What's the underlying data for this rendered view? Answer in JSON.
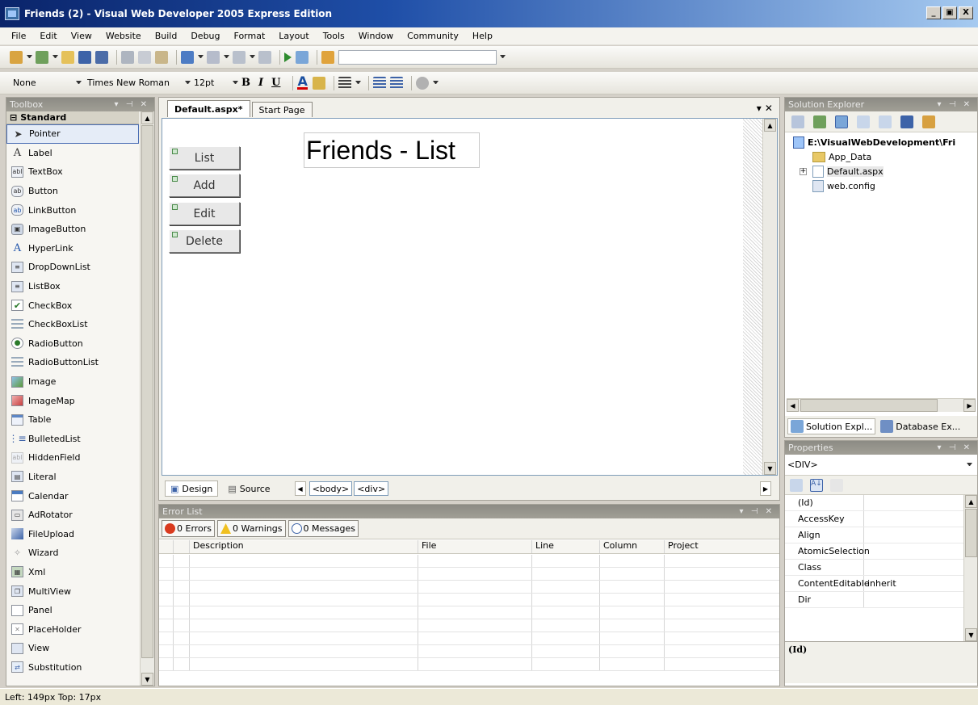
{
  "window": {
    "title": "Friends (2) - Visual Web Developer 2005 Express Edition"
  },
  "menu": [
    "File",
    "Edit",
    "View",
    "Website",
    "Build",
    "Debug",
    "Format",
    "Layout",
    "Tools",
    "Window",
    "Community",
    "Help"
  ],
  "format_toolbar": {
    "block_format": "None",
    "font": "Times New Roman",
    "size": "12pt",
    "bold": "B",
    "italic": "I",
    "underline": "U",
    "color_a": "A"
  },
  "toolbox": {
    "title": "Toolbox",
    "group": "Standard",
    "items": [
      "Pointer",
      "Label",
      "TextBox",
      "Button",
      "LinkButton",
      "ImageButton",
      "HyperLink",
      "DropDownList",
      "ListBox",
      "CheckBox",
      "CheckBoxList",
      "RadioButton",
      "RadioButtonList",
      "Image",
      "ImageMap",
      "Table",
      "BulletedList",
      "HiddenField",
      "Literal",
      "Calendar",
      "AdRotator",
      "FileUpload",
      "Wizard",
      "Xml",
      "MultiView",
      "Panel",
      "PlaceHolder",
      "View",
      "Substitution"
    ]
  },
  "doc": {
    "tabs": [
      "Default.aspx*",
      "Start Page"
    ],
    "buttons": [
      "List",
      "Add",
      "Edit",
      "Delete"
    ],
    "page_title": "Friends - List",
    "views": [
      "Design",
      "Source"
    ],
    "crumbs": [
      "<body>",
      "<div>"
    ]
  },
  "errors": {
    "title": "Error List",
    "errors_label": "0 Errors",
    "warnings_label": "0 Warnings",
    "messages_label": "0 Messages",
    "columns": [
      "Description",
      "File",
      "Line",
      "Column",
      "Project"
    ]
  },
  "solution": {
    "title": "Solution Explorer",
    "root": "E:\\VisualWebDevelopment\\Fri",
    "items": [
      "App_Data",
      "Default.aspx",
      "web.config"
    ],
    "tab1": "Solution Expl...",
    "tab2": "Database Ex..."
  },
  "properties": {
    "title": "Properties",
    "object": "<DIV>",
    "rows": [
      {
        "name": "(Id)",
        "value": ""
      },
      {
        "name": "AccessKey",
        "value": ""
      },
      {
        "name": "Align",
        "value": ""
      },
      {
        "name": "AtomicSelection",
        "value": ""
      },
      {
        "name": "Class",
        "value": ""
      },
      {
        "name": "ContentEditable",
        "value": "inherit"
      },
      {
        "name": "Dir",
        "value": ""
      }
    ],
    "desc": "(Id)"
  },
  "status": {
    "text": "Left: 149px  Top: 17px"
  },
  "colors": {
    "accent": "#0a246a",
    "chrome": "#d4d0c8"
  }
}
